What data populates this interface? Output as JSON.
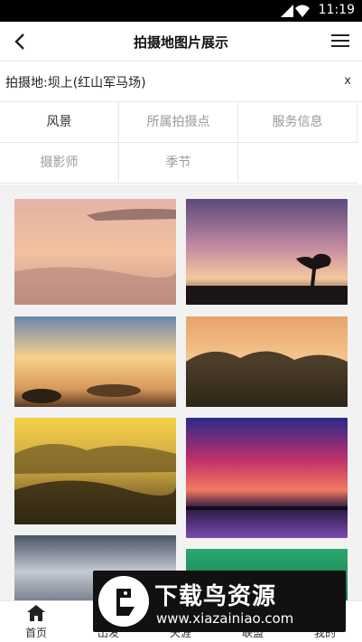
{
  "status_bar": {
    "time": "11:19"
  },
  "header": {
    "title": "拍摄地图片展示"
  },
  "filter": {
    "text": "拍摄地:坝上(红山军马场)",
    "clear_label": "x"
  },
  "tabs": [
    {
      "label": "风景"
    },
    {
      "label": "所属拍摄点"
    },
    {
      "label": "服务信息"
    },
    {
      "label": "摄影师"
    },
    {
      "label": "季节"
    }
  ],
  "bottom_nav": [
    {
      "label": "首页",
      "icon": "home-icon"
    },
    {
      "label": "出发",
      "icon": "compass-icon"
    },
    {
      "label": "天涯",
      "icon": "camera-icon"
    },
    {
      "label": "联盟",
      "icon": "group-icon"
    },
    {
      "label": "我的",
      "icon": "user-icon"
    }
  ],
  "watermark": {
    "title": "下载鸟资源",
    "url": "www.xiazainiao.com"
  }
}
